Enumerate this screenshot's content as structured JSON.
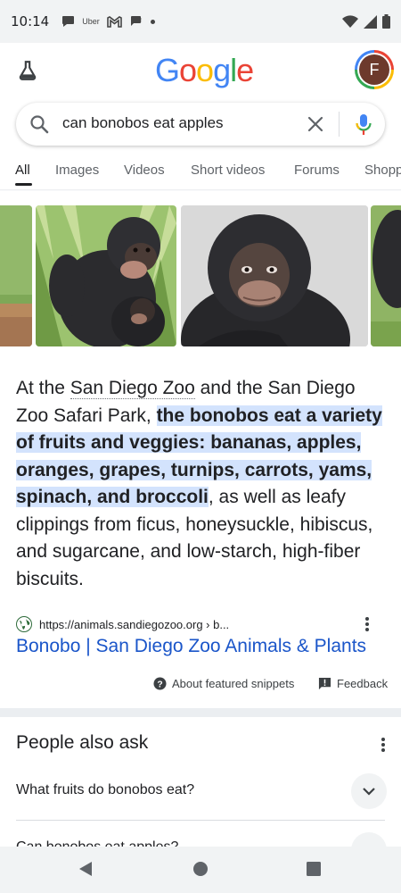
{
  "status_bar": {
    "time": "10:14",
    "uber_label": "Uber"
  },
  "header": {
    "logo": "Google",
    "avatar_initial": "F"
  },
  "search": {
    "query": "can bonobos eat apples"
  },
  "tabs": [
    {
      "label": "All",
      "active": true
    },
    {
      "label": "Images",
      "active": false
    },
    {
      "label": "Videos",
      "active": false
    },
    {
      "label": "Short videos",
      "active": false
    },
    {
      "label": "Forums",
      "active": false
    },
    {
      "label": "Shopping",
      "active": false
    }
  ],
  "featured_snippet": {
    "part1": "At the ",
    "link_text": "San Diego Zoo",
    "part2": " and the San Diego Zoo Safari Park, ",
    "highlight": "the bonobos eat a variety of fruits and veggies: bananas, apples, oranges, grapes, turnips, carrots, yams, spinach, and broccoli",
    "part3": ", as well as leafy clippings from ficus, honeysuckle, hibiscus, and sugarcane, and low-starch, high-fiber biscuits."
  },
  "source": {
    "url": "https://animals.sandiegozoo.org › b...",
    "title": "Bonobo | San Diego Zoo Animals & Plants"
  },
  "snippet_footer": {
    "about_label": "About featured snippets",
    "feedback_label": "Feedback"
  },
  "people_also_ask": {
    "title": "People also ask",
    "questions": [
      "What fruits do bonobos eat?",
      "Can bonobos eat apples?"
    ]
  },
  "colors": {
    "highlight": "#d3e3fd",
    "link": "#1a55c9",
    "status_bar": "#f1f3f4"
  }
}
